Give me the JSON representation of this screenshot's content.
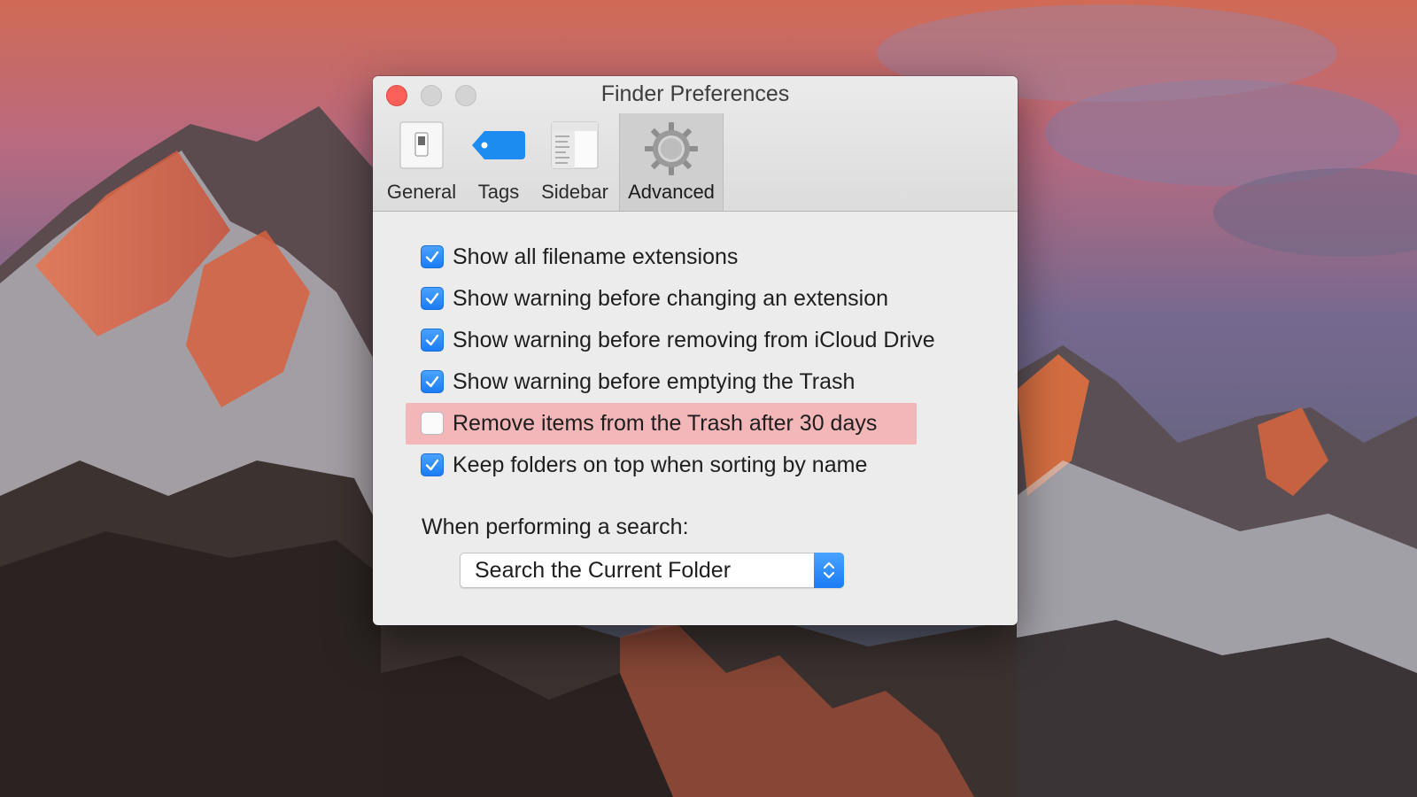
{
  "window": {
    "title": "Finder Preferences"
  },
  "tabs": [
    {
      "label": "General",
      "icon": "general-switch-icon",
      "active": false
    },
    {
      "label": "Tags",
      "icon": "tag-icon",
      "active": false
    },
    {
      "label": "Sidebar",
      "icon": "sidebar-icon",
      "active": false
    },
    {
      "label": "Advanced",
      "icon": "gear-icon",
      "active": true
    }
  ],
  "options": [
    {
      "label": "Show all filename extensions",
      "checked": true
    },
    {
      "label": "Show warning before changing an extension",
      "checked": true
    },
    {
      "label": "Show warning before removing from iCloud Drive",
      "checked": true
    },
    {
      "label": "Show warning before emptying the Trash",
      "checked": true
    },
    {
      "label": "Remove items from the Trash after 30 days",
      "checked": false,
      "highlighted": true
    },
    {
      "label": "Keep folders on top when sorting by name",
      "checked": true
    }
  ],
  "search": {
    "label": "When performing a search:",
    "selected": "Search the Current Folder"
  },
  "colors": {
    "accent": "#1a7cf5",
    "highlight": "#f3b6b9",
    "close": "#fc605b"
  }
}
